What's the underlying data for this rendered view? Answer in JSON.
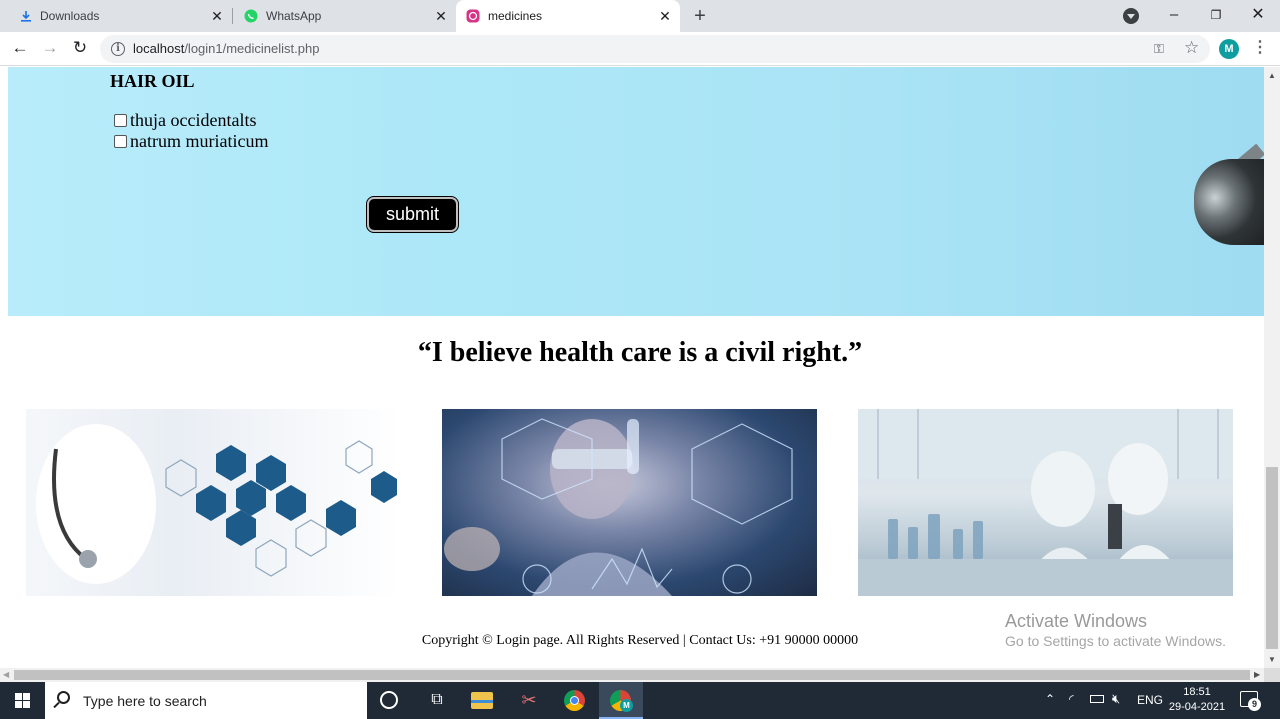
{
  "browser": {
    "tabs": [
      {
        "title": "Downloads",
        "icon": "download-icon"
      },
      {
        "title": "WhatsApp",
        "icon": "whatsapp-icon"
      },
      {
        "title": "medicines",
        "icon": "medicines-site-icon",
        "active": true
      }
    ],
    "address": {
      "host": "localhost",
      "path": "/login1/medicinelist.php"
    },
    "profile_initial": "M",
    "window_controls": {
      "minimize": "–",
      "maximize": "❐",
      "close": "✕"
    }
  },
  "page": {
    "section_heading": "HAIR OIL",
    "options": [
      {
        "label": "thuja occidentalts",
        "checked": false
      },
      {
        "label": "natrum muriaticum",
        "checked": false
      }
    ],
    "submit_label": "submit",
    "quote": "“I believe health care is a civil right.”",
    "images": [
      {
        "name": "medical-icons-photo"
      },
      {
        "name": "lab-scientist-hologram-photo"
      },
      {
        "name": "laboratory-researchers-photo"
      }
    ],
    "footer": "Copyright © Login page. All Rights Reserved | Contact Us: +91 90000 00000"
  },
  "watermark": {
    "title": "Activate Windows",
    "subtitle": "Go to Settings to activate Windows."
  },
  "taskbar": {
    "search_placeholder": "Type here to search",
    "language": "ENG",
    "time": "18:51",
    "date": "29-04-2021",
    "notification_count": "9"
  },
  "colors": {
    "hero_bg": "#b0e8f8",
    "taskbar_bg": "#1f2a36",
    "avatar_bg": "#0f9d9f"
  }
}
